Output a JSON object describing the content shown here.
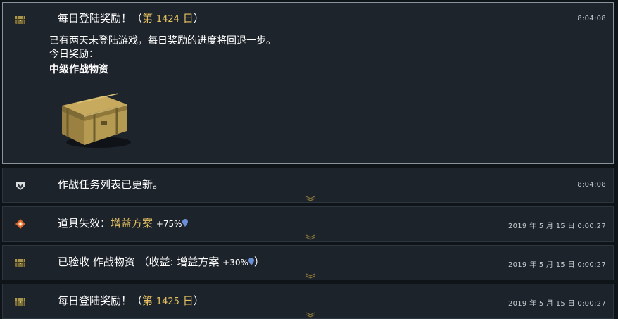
{
  "colors": {
    "background": "#0f1419",
    "card": "#1d232b",
    "highlight": "#e6c261",
    "buff_drop": "#6b8fd6"
  },
  "notifications": [
    {
      "icon": "supply-chest-icon",
      "title_prefix": "每日登陆奖励！（",
      "title_highlight_label": "第",
      "title_number": "1424",
      "title_highlight_suffix": "日",
      "title_close": "）",
      "time": "8:04:08",
      "message": "已有两天未登陆游戏，每日奖励的进度将回退一步。",
      "reward_heading": "今日奖励：",
      "reward_name": "中级作战物资",
      "reward_image": "intermediate-supply-crate"
    },
    {
      "icon": "mission-badge-icon",
      "title": "作战任务列表已更新。",
      "time": "8:04:08"
    },
    {
      "icon": "booster-expired-icon",
      "title_prefix": "道具失效：",
      "booster_name": "增益方案",
      "booster_value": "+75%",
      "time": "2019 年 5 月 15 日 0:00:27"
    },
    {
      "icon": "supply-chest-icon",
      "title_prefix": "已验收 作战物资 （收益: 增益方案",
      "booster_value": "+30%",
      "title_close": "）",
      "time": "2019 年 5 月 15 日 0:00:27"
    },
    {
      "icon": "supply-chest-icon",
      "title_prefix": "每日登陆奖励！（",
      "title_highlight_label": "第",
      "title_number": "1425",
      "title_highlight_suffix": "日",
      "title_close": "）",
      "time": "2019 年 5 月 15 日 0:00:27"
    }
  ]
}
